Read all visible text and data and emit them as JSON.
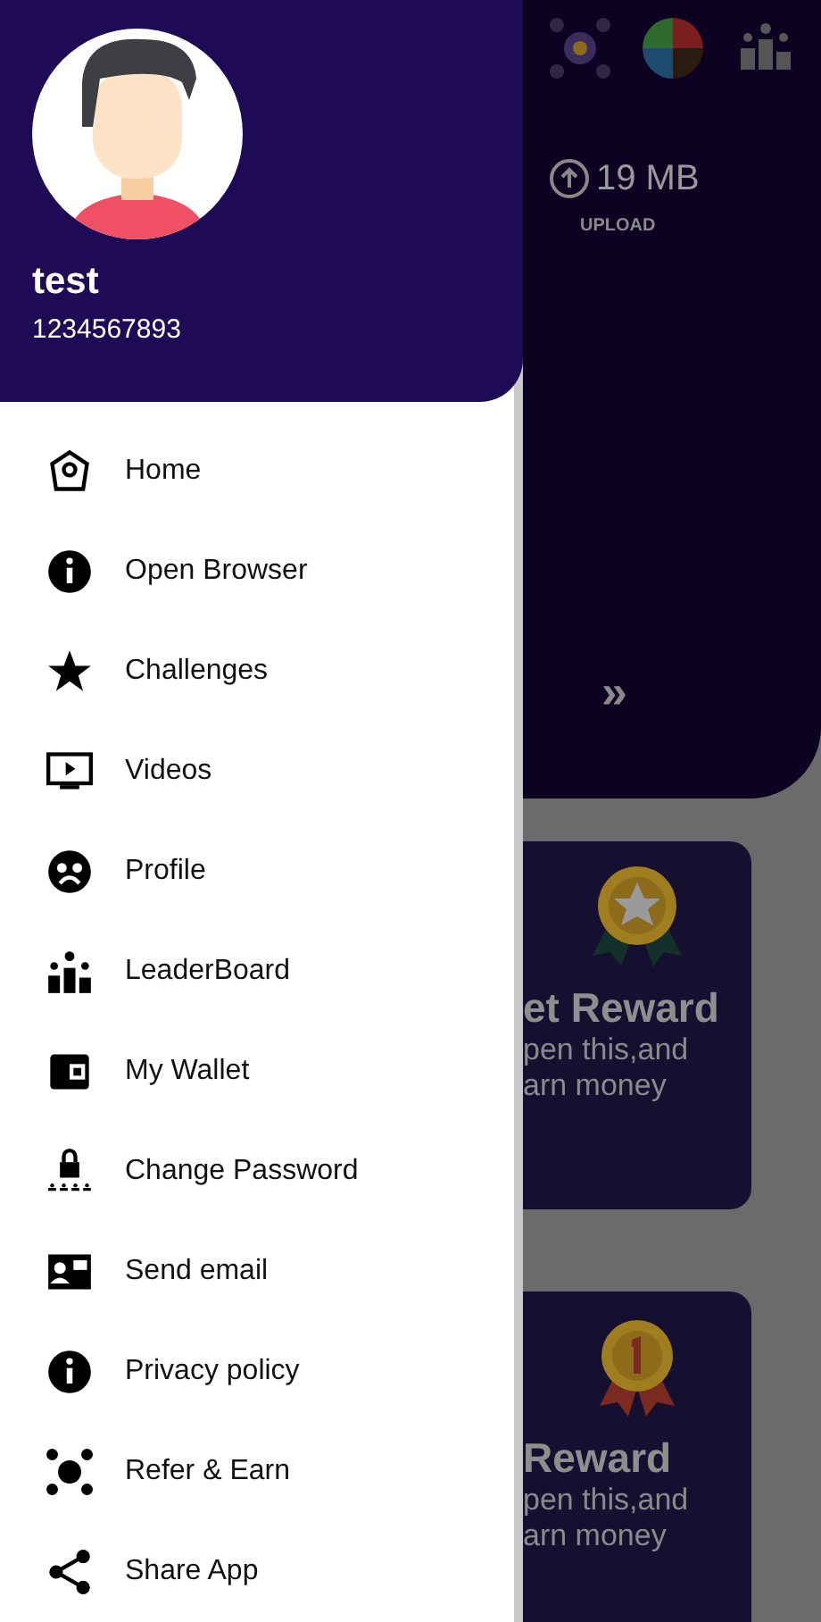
{
  "drawer": {
    "user_name": "test",
    "phone": "1234567893",
    "menu": [
      {
        "label": "Home"
      },
      {
        "label": "Open Browser"
      },
      {
        "label": "Challenges"
      },
      {
        "label": "Videos"
      },
      {
        "label": "Profile"
      },
      {
        "label": "LeaderBoard"
      },
      {
        "label": "My Wallet"
      },
      {
        "label": "Change Password"
      },
      {
        "label": "Send email"
      },
      {
        "label": "Privacy policy"
      },
      {
        "label": "Refer & Earn"
      },
      {
        "label": "Share App"
      }
    ]
  },
  "background": {
    "upload_value": "19 MB",
    "upload_label": "UPLOAD",
    "more": "»",
    "cards": [
      {
        "title": "et Reward",
        "line1": "pen this,and",
        "line2": "arn money"
      },
      {
        "title": "Reward",
        "line1": "pen this,and",
        "line2": "arn money"
      }
    ]
  }
}
